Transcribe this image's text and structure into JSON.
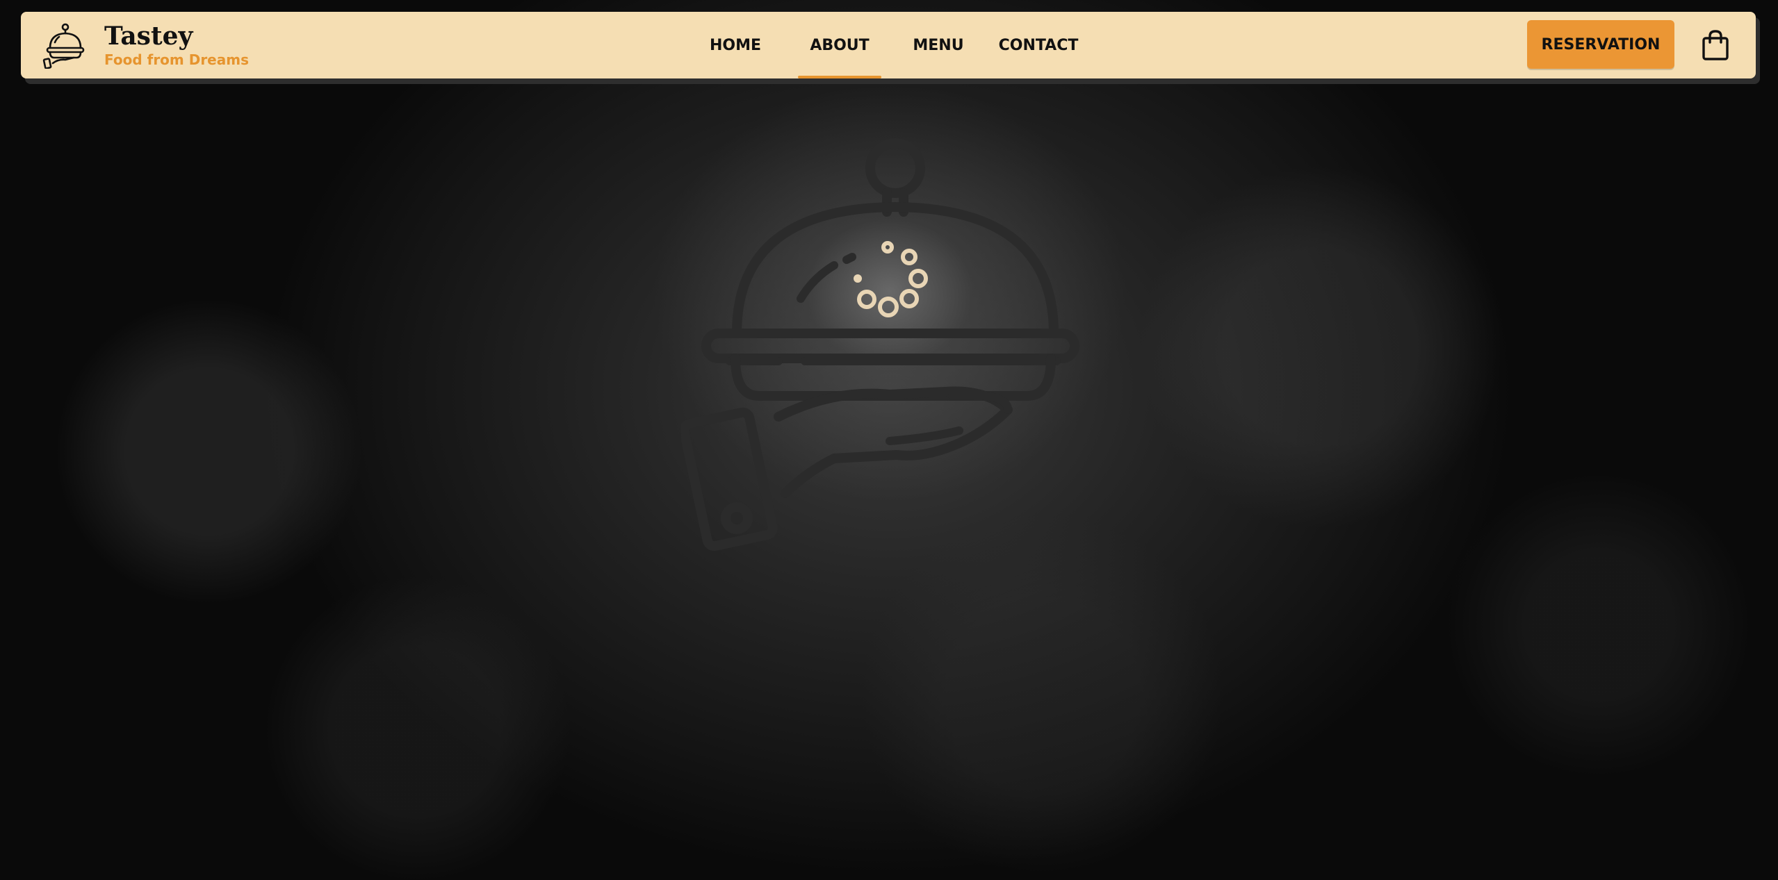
{
  "brand": {
    "name": "Tastey",
    "tagline": "Food from Dreams",
    "logo_icon": "cloche-on-hand-icon"
  },
  "nav": {
    "links": [
      {
        "label": "HOME",
        "active": false
      },
      {
        "label": "ABOUT",
        "active": true
      },
      {
        "label": "MENU",
        "active": false
      },
      {
        "label": "CONTACT",
        "active": false
      }
    ]
  },
  "actions": {
    "reservation_label": "RESERVATION",
    "cart_icon": "shopping-bag-icon"
  },
  "hero": {
    "illustration_icon": "serving-cloche-hand-icon",
    "state": "loading"
  },
  "colors": {
    "navbar_bg": "#f5deb3",
    "accent": "#eb9634",
    "tagline": "#e6942e",
    "background": "#1a1a1a",
    "loader_dots": "#e8d5b5"
  }
}
